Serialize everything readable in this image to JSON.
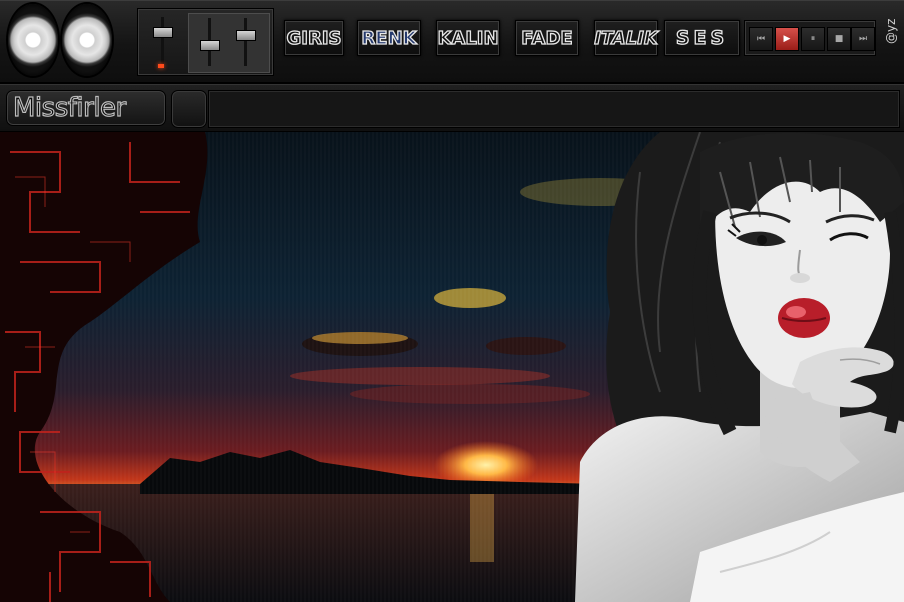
{
  "toolbar": {
    "buttons": {
      "giris": "GIRIS",
      "renk": "RENK",
      "kalin": "KALIN",
      "fade": "FADE",
      "italik": "ITALIK",
      "ses": "SES"
    },
    "transport": {
      "prev": "⏮",
      "play": "▶",
      "pause": "⏸",
      "stop": "■",
      "next": "⏭"
    },
    "handle": "@yz"
  },
  "titlebar": {
    "nickname": "Missfirler"
  },
  "icons": [
    "speaker-left-icon",
    "speaker-right-icon",
    "volume-slider-icon",
    "prev-icon",
    "play-icon",
    "pause-icon",
    "stop-icon",
    "next-icon"
  ],
  "colors": {
    "accent_red": "#c0271f",
    "panel_dark": "#141414",
    "text_stroke": "#e8e8e8"
  }
}
